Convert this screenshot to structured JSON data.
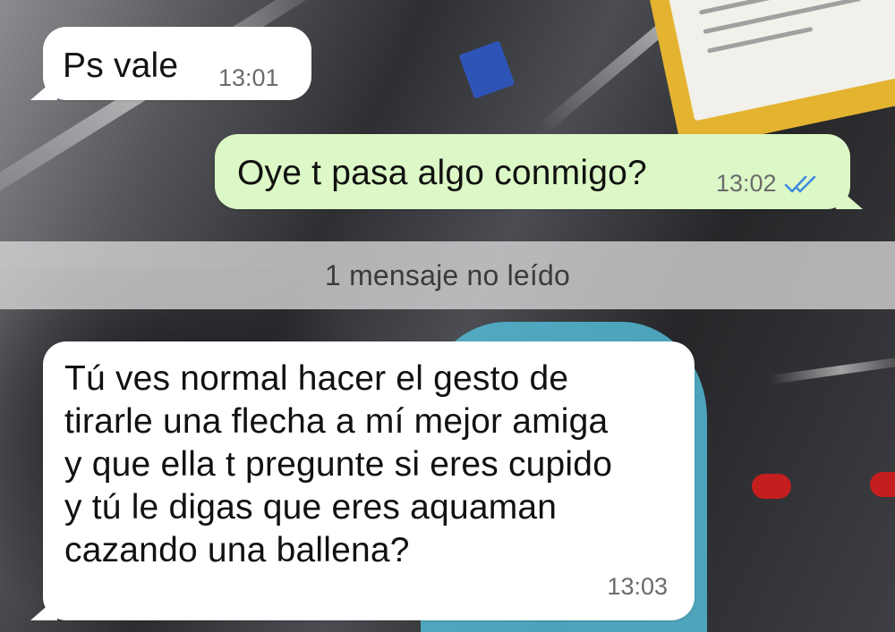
{
  "messages": [
    {
      "direction": "incoming",
      "text": "Ps vale",
      "time": "13:01"
    },
    {
      "direction": "outgoing",
      "text": "Oye t pasa algo conmigo?",
      "time": "13:02",
      "status_icon": "double-check-read-icon",
      "status_color": "#3f8ae0"
    },
    {
      "direction": "incoming",
      "text": "Tú ves normal hacer el gesto de\ntirarle una flecha a mí mejor amiga\ny que ella t pregunte si eres cupido\ny tú le digas que eres aquaman\ncazando una ballena?",
      "time": "13:03"
    }
  ],
  "unread_banner": {
    "label": "1 mensaje no leído"
  },
  "colors": {
    "incoming_bubble": "#ffffff",
    "outgoing_bubble": "#dcf8c6",
    "banner": "#d7d7d7"
  }
}
